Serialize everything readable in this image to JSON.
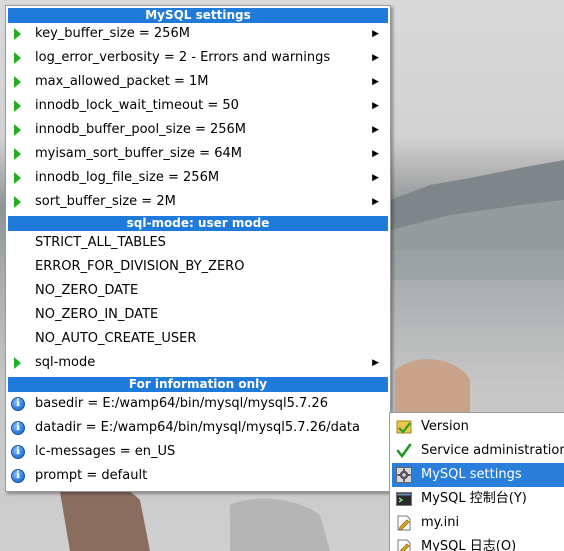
{
  "main_menu": {
    "header_settings": "MySQL settings",
    "settings_items": [
      {
        "label": "key_buffer_size = 256M",
        "arrow": "▶"
      },
      {
        "label": "log_error_verbosity = 2 - Errors and warnings",
        "arrow": "▶"
      },
      {
        "label": "max_allowed_packet = 1M",
        "arrow": "▶"
      },
      {
        "label": "innodb_lock_wait_timeout = 50",
        "arrow": "▶"
      },
      {
        "label": "innodb_buffer_pool_size = 256M",
        "arrow": "▶"
      },
      {
        "label": "myisam_sort_buffer_size = 64M",
        "arrow": "▶"
      },
      {
        "label": "innodb_log_file_size = 256M",
        "arrow": "▶"
      },
      {
        "label": "sort_buffer_size = 2M",
        "arrow": "▶"
      }
    ],
    "header_sqlmode": "sql-mode: user mode",
    "sqlmode_items": [
      "STRICT_ALL_TABLES",
      "ERROR_FOR_DIVISION_BY_ZERO",
      "NO_ZERO_DATE",
      "NO_ZERO_IN_DATE",
      "NO_AUTO_CREATE_USER"
    ],
    "sqlmode_submenu": {
      "label": "sql-mode",
      "arrow": "▶"
    },
    "header_info": "For information only",
    "info_items": [
      "basedir = E:/wamp64/bin/mysql/mysql5.7.26",
      "datadir = E:/wamp64/bin/mysql/mysql5.7.26/data",
      "lc-messages = en_US",
      "prompt = default"
    ],
    "info_icon_glyph": "i"
  },
  "right_menu": {
    "items": [
      {
        "label": "Version",
        "icon": "version-icon"
      },
      {
        "label": "Service administration",
        "icon": "checkmark-icon"
      },
      {
        "label": "MySQL settings",
        "icon": "gear-icon",
        "selected": true
      },
      {
        "label": "MySQL 控制台(Y)",
        "icon": "console-icon"
      },
      {
        "label": "my.ini",
        "icon": "ini-file-icon"
      },
      {
        "label": "MySQL 日志(O)",
        "icon": "log-file-icon"
      }
    ]
  },
  "colors": {
    "header_blue": "#1f7ad9",
    "selected_blue": "#2a7fdb",
    "arrow_green": "#22b022"
  }
}
